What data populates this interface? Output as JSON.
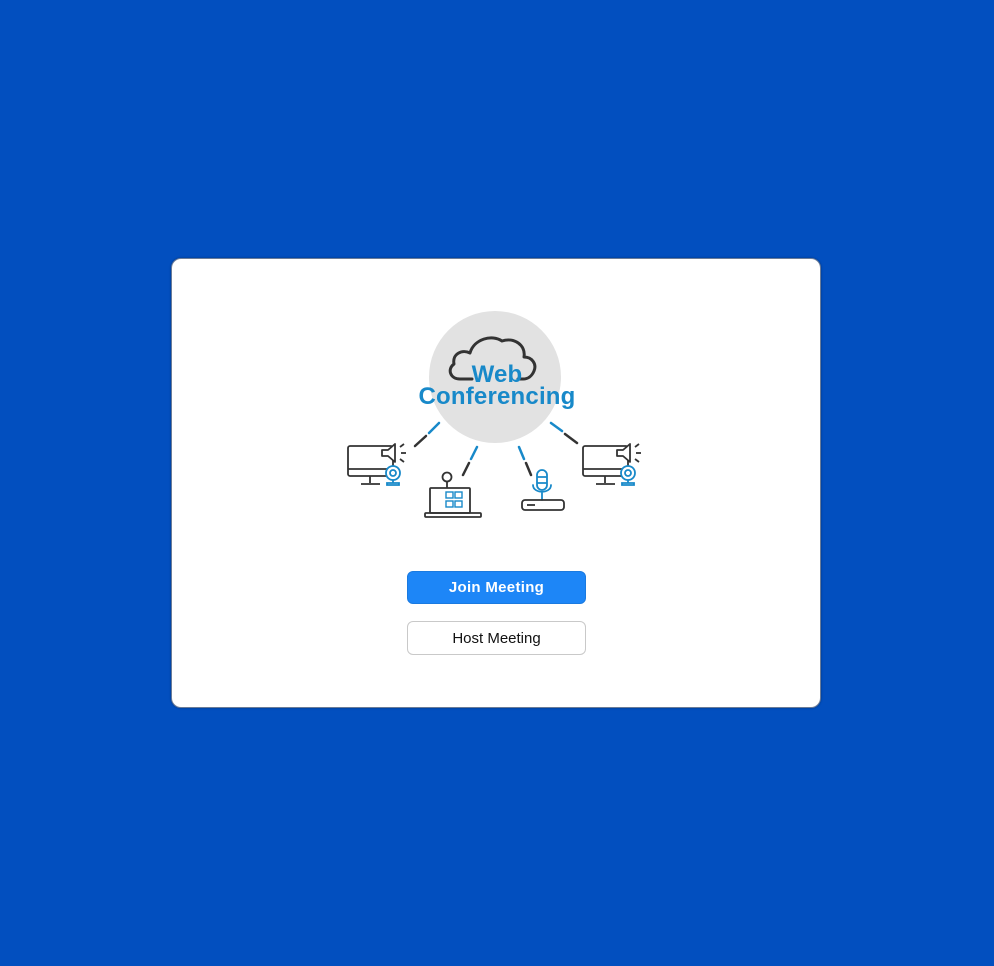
{
  "logo": {
    "line1": "Web",
    "line2": "Conferencing"
  },
  "actions": {
    "join_label": "Join Meeting",
    "host_label": "Host Meeting"
  },
  "colors": {
    "background": "#024fbf",
    "primary_button": "#1d86f7",
    "accent": "#1889c9",
    "icon_dark": "#333333"
  }
}
